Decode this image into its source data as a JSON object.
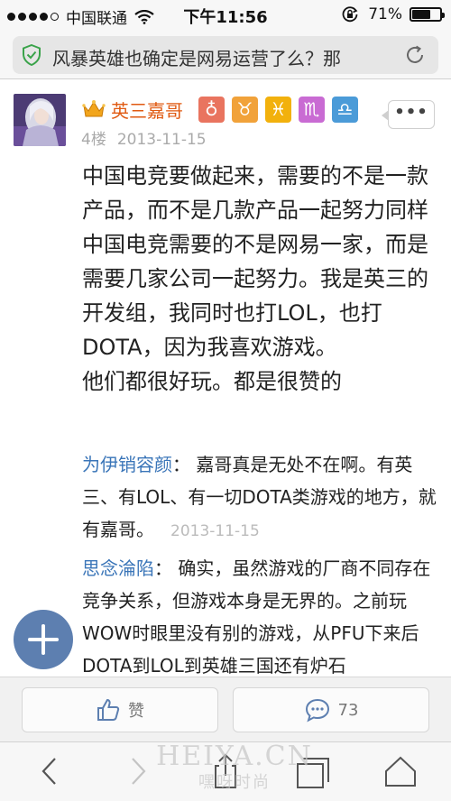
{
  "status_bar": {
    "carrier": "中国联通",
    "time": "下午11:56",
    "battery_percent": "71%",
    "battery_level": 0.71,
    "signal_bars_filled": 4,
    "signal_bars_total": 5
  },
  "address_bar": {
    "url_title": "风暴英雄也确定是网易运营了么？那",
    "secure_icon": "shield-check-icon",
    "reload_icon": "reload-icon"
  },
  "post": {
    "username": "英三嘉哥",
    "badges": [
      "♁",
      "♉",
      "♓",
      "♏",
      "♎"
    ],
    "floor": "4楼",
    "date": "2013-11-15",
    "more_label": "•••",
    "paragraphs": [
      "中国电竞要做起来，需要的不是一款产品，而不是几款产品一起努力同样中国电竞需要的不是网易一家，而是需要几家公司一起努力。我是英三的开发组，我同时也打LOL，也打DOTA，因为我喜欢游戏。",
      "他们都很好玩。都是很赞的"
    ]
  },
  "replies": [
    {
      "name": "为伊销容颜",
      "sep": "：",
      "text": "嘉哥真是无处不在啊。有英三、有LOL、有一切DOTA类游戏的地方，就有嘉哥。",
      "date": "2013-11-15"
    },
    {
      "name": "思念淪陷",
      "sep": "：",
      "text": "确实，虽然游戏的厂商不同存在竞争关系，但游戏本身是无界的。之前玩WOW时眼里没有别的游戏，从PFU下来后DOTA到LOL到英雄三国还有炉石",
      "date": ""
    }
  ],
  "actions": {
    "like_label": "赞",
    "comment_count": "73"
  },
  "watermark": {
    "line1": "HEIYA.CN",
    "line2": "嘿呀时尚"
  },
  "colors": {
    "username": "#e05a12",
    "reply_name": "#3a75b8",
    "fab": "#5d7fb0"
  }
}
